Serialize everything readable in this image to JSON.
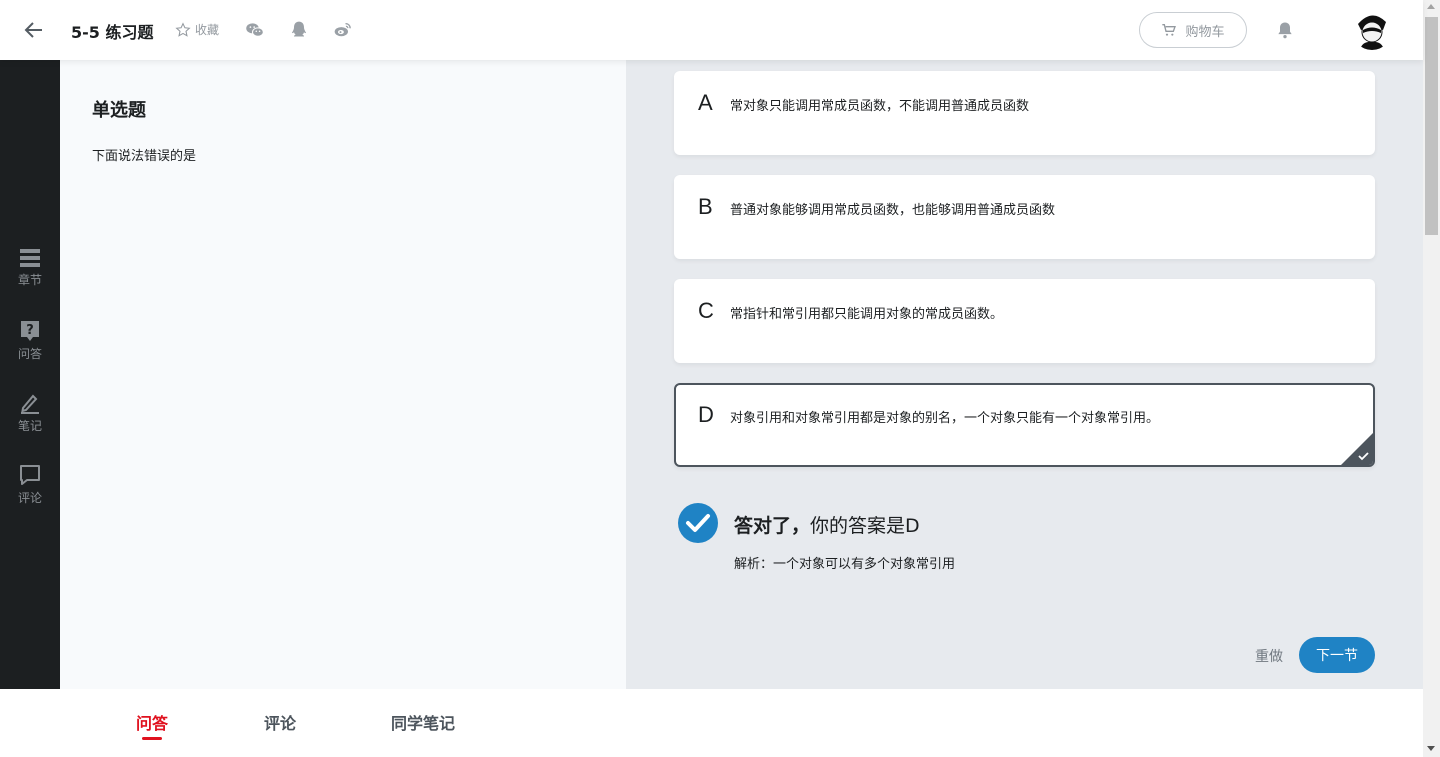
{
  "header": {
    "title": "5-5 练习题",
    "favorite_label": "收藏",
    "cart_label": "购物车",
    "share_icons": [
      "wechat-icon",
      "qq-icon",
      "weibo-icon"
    ]
  },
  "sidebar": {
    "items": [
      {
        "label": "章节",
        "icon": "chapters-icon"
      },
      {
        "label": "问答",
        "icon": "question-icon"
      },
      {
        "label": "笔记",
        "icon": "pencil-icon"
      },
      {
        "label": "评论",
        "icon": "comment-icon"
      }
    ]
  },
  "question": {
    "type": "单选题",
    "text": "下面说法错误的是"
  },
  "options": [
    {
      "letter": "A",
      "text": "常对象只能调用常成员函数，不能调用普通成员函数",
      "selected": false
    },
    {
      "letter": "B",
      "text": "普通对象能够调用常成员函数，也能够调用普通成员函数",
      "selected": false
    },
    {
      "letter": "C",
      "text": "常指针和常引用都只能调用对象的常成员函数。",
      "selected": false
    },
    {
      "letter": "D",
      "text": "对象引用和对象常引用都是对象的别名，一个对象只能有一个对象常引用。",
      "selected": true
    }
  ],
  "result": {
    "status": "答对了，",
    "answer_text": "你的答案是D",
    "analysis": "解析：一个对象可以有多个对象常引用"
  },
  "actions": {
    "redo_label": "重做",
    "next_label": "下一节"
  },
  "bottom_tabs": [
    {
      "label": "问答",
      "active": true
    },
    {
      "label": "评论",
      "active": false
    },
    {
      "label": "同学笔记",
      "active": false
    }
  ],
  "colors": {
    "accent_blue": "#1f83c5",
    "active_red": "#e0111e",
    "sidebar_bg": "#1c1f21",
    "answer_bg": "#e7eaee"
  }
}
